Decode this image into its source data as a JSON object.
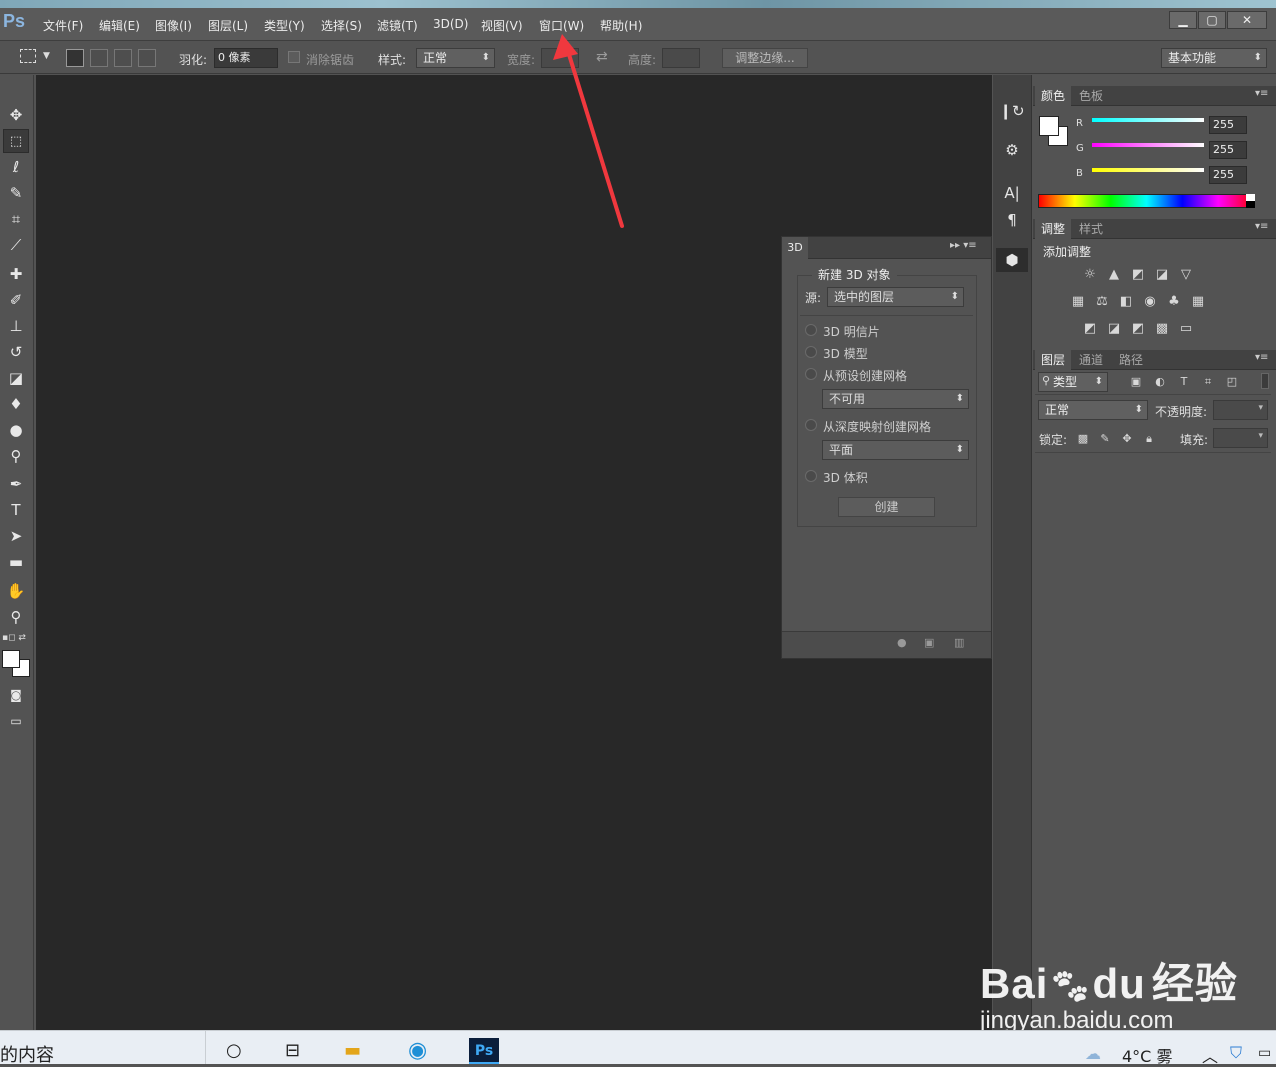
{
  "app": {
    "logo": "Ps"
  },
  "menu": [
    "文件(F)",
    "编辑(E)",
    "图像(I)",
    "图层(L)",
    "类型(Y)",
    "选择(S)",
    "滤镜(T)",
    "3D(D)",
    "视图(V)",
    "窗口(W)",
    "帮助(H)"
  ],
  "window_controls": {
    "minimize": "▁",
    "maximize": "▢",
    "close": "✕"
  },
  "options": {
    "feather_label": "羽化:",
    "feather_value": "0 像素",
    "antialias_label": "消除锯齿",
    "style_label": "样式:",
    "style_value": "正常",
    "width_label": "宽度:",
    "height_label": "高度:",
    "refine_button": "调整边缘...",
    "workspace": "基本功能"
  },
  "panel3d": {
    "tab": "3D",
    "group_title": "新建 3D 对象",
    "source_label": "源:",
    "source_value": "选中的图层",
    "options": [
      "3D 明信片",
      "3D 模型",
      "从预设创建网格",
      "从深度映射创建网格",
      "3D 体积"
    ],
    "preset_value": "不可用",
    "depth_value": "平面",
    "create_button": "创建"
  },
  "color_panel": {
    "tabs": [
      "颜色",
      "色板"
    ],
    "r_label": "R",
    "g_label": "G",
    "b_label": "B",
    "r": "255",
    "g": "255",
    "b": "255"
  },
  "adjust_panel": {
    "tabs": [
      "调整",
      "样式"
    ],
    "title": "添加调整"
  },
  "layers_panel": {
    "tabs": [
      "图层",
      "通道",
      "路径"
    ],
    "filter": "类型",
    "blend": "正常",
    "opacity_label": "不透明度:",
    "lock_label": "锁定:",
    "fill_label": "填充:"
  },
  "taskbar": {
    "left_text": "的内容",
    "weather": "4°C 雾"
  },
  "watermark": {
    "brand": "Bai",
    "brand_suffix": "du",
    "suffix_cn": "经验",
    "url": "jingyan.baidu.com"
  },
  "colors": {
    "arrow": "#f0383e",
    "canvas": "#282828",
    "panel": "#535353"
  }
}
